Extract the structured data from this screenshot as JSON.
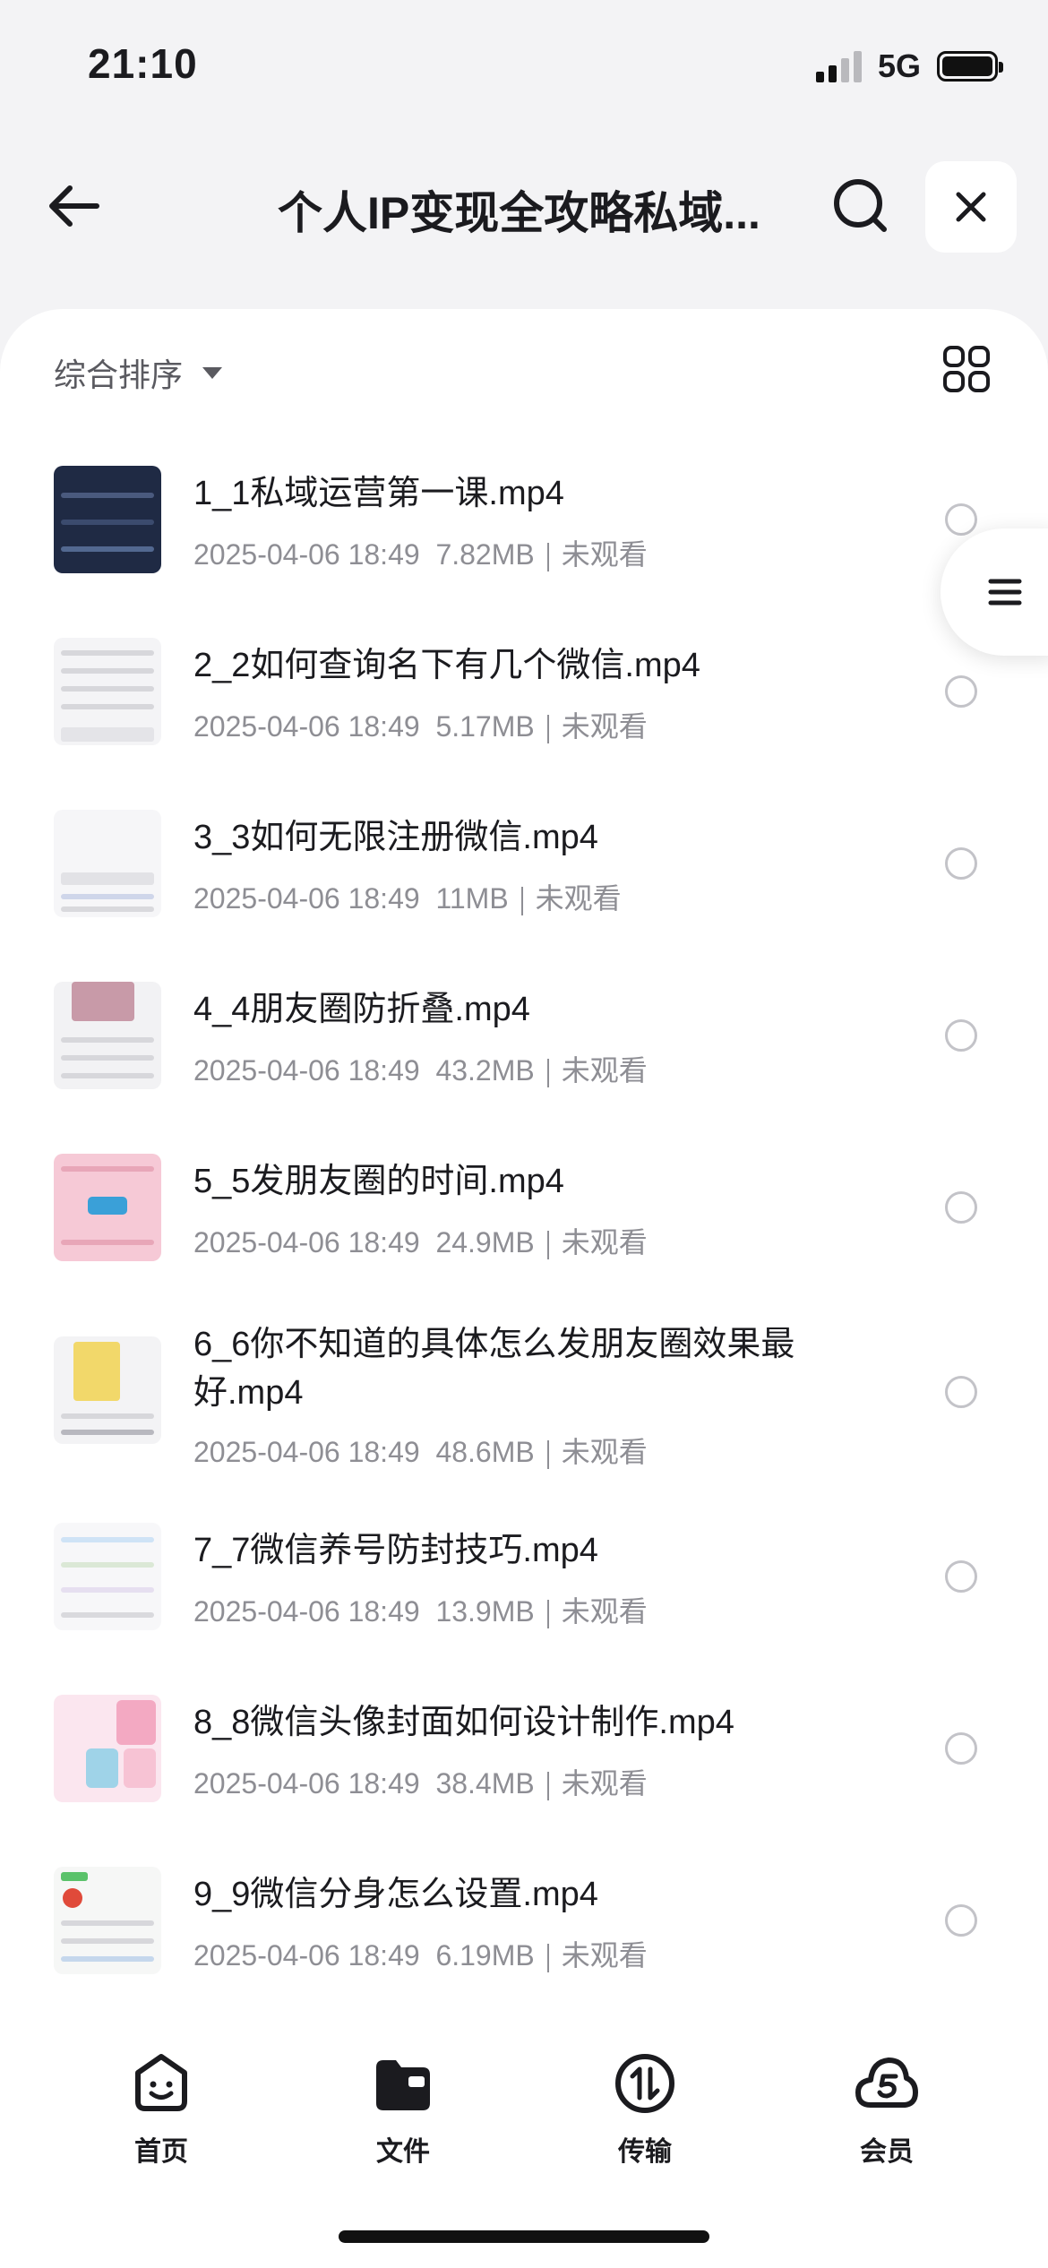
{
  "status": {
    "time": "21:10",
    "network": "5G"
  },
  "nav": {
    "title": "个人IP变现全攻略私域..."
  },
  "sort": {
    "label": "综合排序"
  },
  "files": [
    {
      "name": "1_1私域运营第一课.mp4",
      "date": "2025-04-06 18:49",
      "size": "7.82MB",
      "status": "未观看"
    },
    {
      "name": "2_2如何查询名下有几个微信.mp4",
      "date": "2025-04-06 18:49",
      "size": "5.17MB",
      "status": "未观看"
    },
    {
      "name": "3_3如何无限注册微信.mp4",
      "date": "2025-04-06 18:49",
      "size": "11MB",
      "status": "未观看"
    },
    {
      "name": "4_4朋友圈防折叠.mp4",
      "date": "2025-04-06 18:49",
      "size": "43.2MB",
      "status": "未观看"
    },
    {
      "name": "5_5发朋友圈的时间.mp4",
      "date": "2025-04-06 18:49",
      "size": "24.9MB",
      "status": "未观看"
    },
    {
      "name": "6_6你不知道的具体怎么发朋友圈效果最好.mp4",
      "date": "2025-04-06 18:49",
      "size": "48.6MB",
      "status": "未观看"
    },
    {
      "name": "7_7微信养号防封技巧.mp4",
      "date": "2025-04-06 18:49",
      "size": "13.9MB",
      "status": "未观看"
    },
    {
      "name": "8_8微信头像封面如何设计制作.mp4",
      "date": "2025-04-06 18:49",
      "size": "38.4MB",
      "status": "未观看"
    },
    {
      "name": "9_9微信分身怎么设置.mp4",
      "date": "2025-04-06 18:49",
      "size": "6.19MB",
      "status": "未观看"
    }
  ],
  "tabs": [
    {
      "label": "首页",
      "icon": "smile-box-icon"
    },
    {
      "label": "文件",
      "icon": "folder-icon"
    },
    {
      "label": "传输",
      "icon": "transfer-icon"
    },
    {
      "label": "会员",
      "icon": "cloud-member-icon"
    }
  ],
  "colors": {
    "accent": "#1b1b1f",
    "muted": "#8e8e94",
    "background": "#f3f3f5"
  }
}
